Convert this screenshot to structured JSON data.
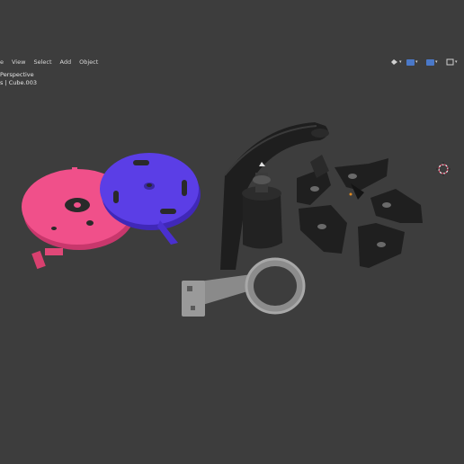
{
  "header": {
    "menus": [
      "View",
      "Select",
      "Add",
      "Object"
    ],
    "first_menu_partial": "e"
  },
  "overlay": {
    "view_name": "Perspective",
    "object_label": "s | Cube.003"
  },
  "header_right": {
    "icons": [
      "visibility-toggle-icon",
      "gizmo-icon",
      "overlays-icon",
      "shading-icon"
    ],
    "accent": "#4a78c8"
  },
  "scene": {
    "objects": [
      "pink-gear-disc",
      "purple-gear-disc",
      "black-arm",
      "black-bell",
      "grey-ring-clamp",
      "black-segment-1",
      "black-segment-2",
      "black-segment-3",
      "black-segment-4",
      "black-segment-5",
      "black-segment-6"
    ],
    "colors": {
      "pink": "#f0508a",
      "purple": "#5b3ee6",
      "black": "#1e1e1e",
      "grey": "#9a9a9a",
      "background": "#3d3d3d",
      "cursor": "#d63a5a"
    }
  }
}
